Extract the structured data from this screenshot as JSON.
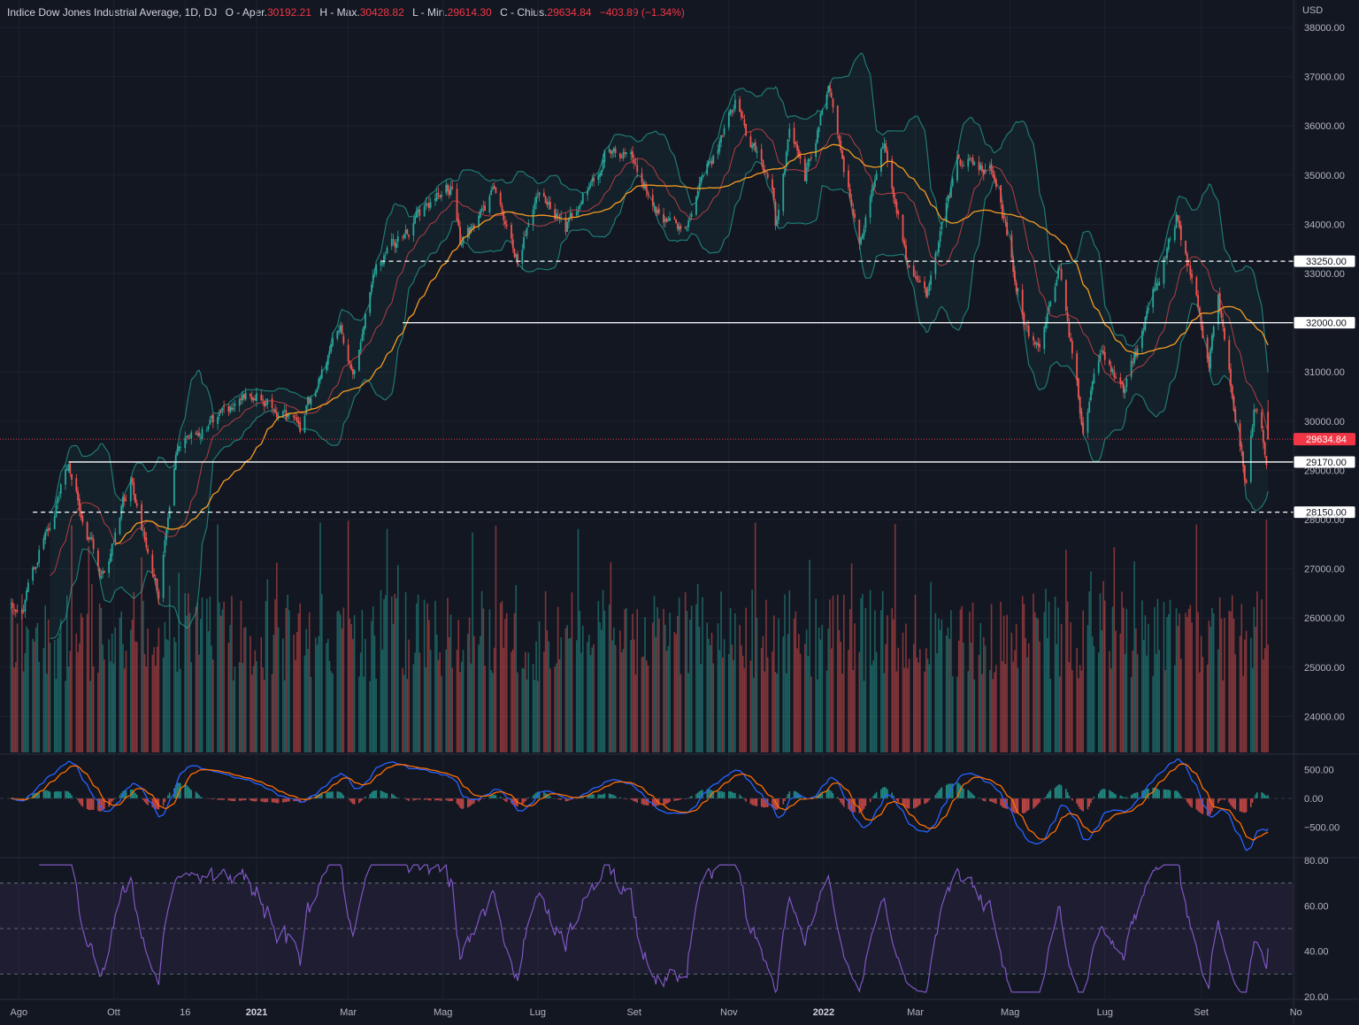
{
  "header": {
    "title": "Indice Dow Jones Industrial Average, 1D, DJ",
    "open_label": "O - Aper.",
    "open": "30192.21",
    "high_label": "H - Max.",
    "high": "30428.82",
    "low_label": "L - Min.",
    "low": "29614.30",
    "close_label": "C - Chius.",
    "close": "29634.84",
    "change": "−403.89 (−1.34%)"
  },
  "colors": {
    "background": "#131722",
    "up": "#26a69a",
    "down": "#ef5350",
    "ma_fast": "#e8474d",
    "ma_slow": "#f59a23",
    "bollinger": "#1f7a74",
    "macd": "#2962ff",
    "signal": "#ff6d00",
    "rsi": "#7e57c2",
    "last_price": "#f23645"
  },
  "chart_data": {
    "type": "candlestick",
    "title": "Indice Dow Jones Industrial Average, 1D, DJ",
    "currency": "USD",
    "price_ticks": [
      "38000.00",
      "37000.00",
      "36000.00",
      "35000.00",
      "34000.00",
      "33000.00",
      "31000.00",
      "30000.00",
      "29000.00",
      "28000.00",
      "27000.00",
      "26000.00",
      "25000.00",
      "24000.00"
    ],
    "price_range": [
      23300,
      38300
    ],
    "x_ticks": [
      [
        "Ago",
        "2020-08-01"
      ],
      [
        "Ott",
        "2020-10-01"
      ],
      [
        "16",
        "2020-11-16"
      ],
      [
        "2021",
        "2021-01-01"
      ],
      [
        "Mar",
        "2021-03-01"
      ],
      [
        "Mag",
        "2021-05-01"
      ],
      [
        "Lug",
        "2021-07-01"
      ],
      [
        "Set",
        "2021-09-01"
      ],
      [
        "Nov",
        "2021-11-01"
      ],
      [
        "2022",
        "2022-01-01"
      ],
      [
        "Mar",
        "2022-03-01"
      ],
      [
        "Mag",
        "2022-05-01"
      ],
      [
        "Lug",
        "2022-07-01"
      ],
      [
        "Set",
        "2022-09-01"
      ],
      [
        "No",
        "2022-11-01"
      ]
    ],
    "price_path": [
      [
        "2020-07-27",
        26400
      ],
      [
        "2020-08-03",
        26300
      ],
      [
        "2020-09-02",
        29100
      ],
      [
        "2020-09-23",
        26800
      ],
      [
        "2020-10-12",
        28800
      ],
      [
        "2020-10-30",
        26500
      ],
      [
        "2020-11-10",
        29400
      ],
      [
        "2020-12-31",
        30600
      ],
      [
        "2021-01-29",
        29900
      ],
      [
        "2021-02-24",
        31900
      ],
      [
        "2021-03-04",
        30900
      ],
      [
        "2021-03-17",
        33000
      ],
      [
        "2021-04-16",
        34200
      ],
      [
        "2021-05-07",
        34800
      ],
      [
        "2021-05-12",
        33600
      ],
      [
        "2021-06-04",
        34700
      ],
      [
        "2021-06-18",
        33300
      ],
      [
        "2021-07-02",
        34700
      ],
      [
        "2021-07-19",
        33900
      ],
      [
        "2021-08-16",
        35600
      ],
      [
        "2021-09-02",
        35300
      ],
      [
        "2021-09-20",
        33900
      ],
      [
        "2021-10-04",
        34000
      ],
      [
        "2021-11-05",
        36400
      ],
      [
        "2021-11-30",
        34500
      ],
      [
        "2021-12-01",
        34000
      ],
      [
        "2021-12-10",
        35900
      ],
      [
        "2021-12-20",
        34900
      ],
      [
        "2022-01-04",
        36800
      ],
      [
        "2022-01-24",
        33600
      ],
      [
        "2022-02-09",
        35700
      ],
      [
        "2022-02-24",
        33200
      ],
      [
        "2022-03-08",
        32600
      ],
      [
        "2022-03-29",
        35300
      ],
      [
        "2022-04-20",
        35100
      ],
      [
        "2022-05-12",
        31800
      ],
      [
        "2022-05-20",
        31300
      ],
      [
        "2022-06-02",
        33200
      ],
      [
        "2022-06-17",
        29900
      ],
      [
        "2022-06-28",
        31400
      ],
      [
        "2022-07-14",
        30600
      ],
      [
        "2022-08-16",
        34150
      ],
      [
        "2022-09-06",
        31300
      ],
      [
        "2022-09-12",
        32400
      ],
      [
        "2022-09-30",
        28800
      ],
      [
        "2022-10-05",
        30300
      ],
      [
        "2022-10-13",
        29300
      ],
      [
        "2022-10-14",
        29634.84
      ]
    ],
    "horizontal_levels": [
      {
        "price": 33250,
        "label": "33250.00",
        "style": "dashed",
        "from": "2021-03-22"
      },
      {
        "price": 32000,
        "label": "32000.00",
        "style": "solid",
        "from": "2021-04-05"
      },
      {
        "price": 29170,
        "label": "29170.00",
        "style": "solid",
        "from": "2020-09-02"
      },
      {
        "price": 28150,
        "label": "28150.00",
        "style": "dashed",
        "from": "2020-08-10"
      }
    ],
    "last_price": {
      "value": 29634.84,
      "label": "29634.84"
    },
    "indicators": [
      "Bollinger Bands (20,2)",
      "SMA 20",
      "SMA 50",
      "Volume",
      "MACD (12,26,9)",
      "RSI (14)"
    ],
    "macd_ticks": [
      "500.00",
      "0.00",
      "−500.00"
    ],
    "rsi_ticks": [
      "80.00",
      "60.00",
      "40.00",
      "20.00"
    ],
    "rsi_band": [
      30,
      70
    ]
  }
}
